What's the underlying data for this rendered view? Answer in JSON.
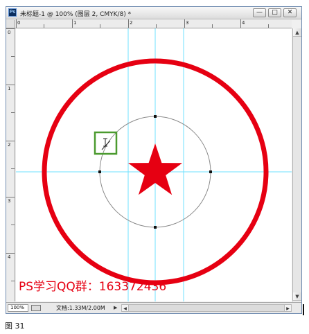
{
  "window": {
    "title": "未标题-1 @ 100% (图层 2, CMYK/8) *",
    "minimize_label": "—",
    "maximize_label": "□",
    "close_label": "✕"
  },
  "ruler": {
    "top_labels": [
      "0",
      "1",
      "2",
      "3",
      "4"
    ],
    "left_labels": [
      "0",
      "1",
      "2",
      "3",
      "4"
    ]
  },
  "canvas": {
    "ring_color": "#e60012",
    "star_color": "#e60012",
    "guide_color": "#6fe0ff",
    "selection_box_color": "#4b9a2f",
    "watermark": "PS学习QQ群：163372436"
  },
  "statusbar": {
    "zoom": "100%",
    "doc_info": "文档:1.33M/2.00M",
    "arrow": "▶",
    "scroll_left": "◀",
    "scroll_right": "▶"
  },
  "vscroll": {
    "up": "▲",
    "down": "▼"
  },
  "caption": "图 31"
}
